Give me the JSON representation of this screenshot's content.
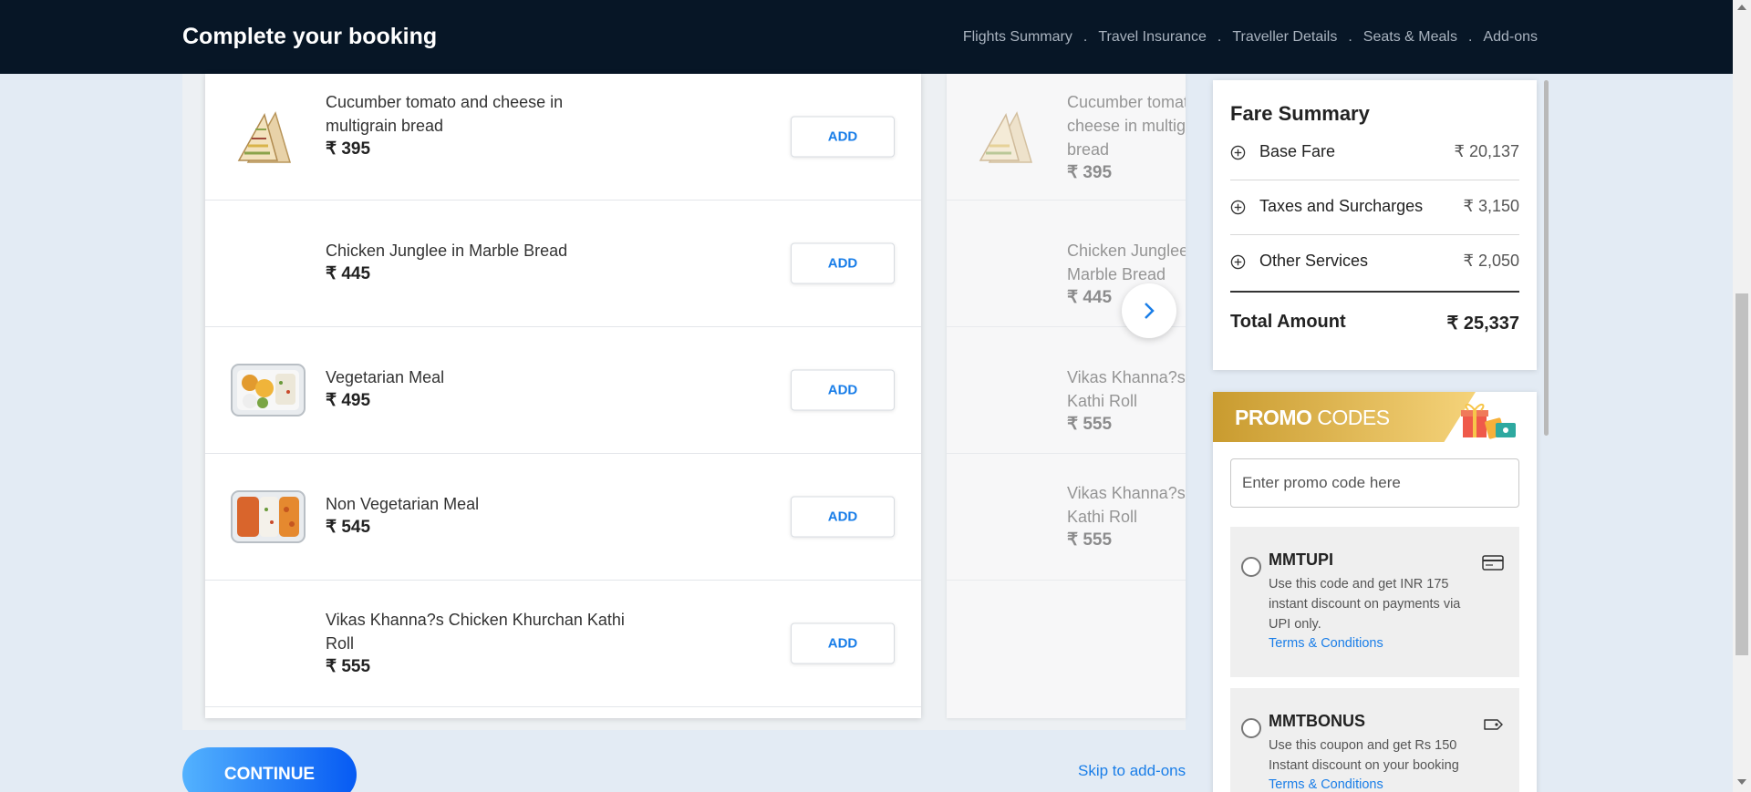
{
  "header": {
    "title": "Complete your booking",
    "steps": [
      "Flights Summary",
      "Travel Insurance",
      "Traveller Details",
      "Seats & Meals",
      "Add-ons"
    ]
  },
  "meals": [
    {
      "name": "Cucumber tomato and cheese in multigrain bread",
      "price": "₹ 395",
      "icon": "sandwich-image"
    },
    {
      "name": "Chicken Junglee in Marble Bread",
      "price": "₹ 445",
      "icon": ""
    },
    {
      "name": "Vegetarian Meal",
      "price": "₹ 495",
      "icon": "veg-meal-image"
    },
    {
      "name": "Non Vegetarian Meal",
      "price": "₹ 545",
      "icon": "nonveg-meal-image"
    },
    {
      "name": "Vikas Khanna?s Chicken Khurchan Kathi Roll",
      "price": "₹ 555",
      "icon": ""
    }
  ],
  "meals_next": [
    {
      "name": "Cucumber tomato and cheese in multigrain bread",
      "price": "₹ 395"
    },
    {
      "name": "Chicken Junglee in Marble Bread",
      "price": "₹ 445"
    },
    {
      "name": "Vikas Khanna?s Paneer Kathi Roll",
      "price": "₹ 555"
    },
    {
      "name": "Vikas Khanna?s Chicken Kathi Roll",
      "price": "₹ 555"
    }
  ],
  "add_label": "ADD",
  "continue_label": "CONTINUE",
  "skip_label": "Skip to add-ons",
  "fare": {
    "title": "Fare Summary",
    "rows": [
      {
        "label": "Base Fare",
        "amount": "₹ 20,137"
      },
      {
        "label": "Taxes and Surcharges",
        "amount": "₹ 3,150"
      },
      {
        "label": "Other Services",
        "amount": "₹ 2,050"
      }
    ],
    "total_label": "Total Amount",
    "total_amount": "₹ 25,337"
  },
  "promo": {
    "title_bold": "PROMO",
    "title_rest": " CODES",
    "placeholder": "Enter promo code here",
    "coupons": [
      {
        "code": "MMTUPI",
        "desc": "Use this code and get INR 175 instant discount on payments via UPI only.",
        "tc": "Terms & Conditions",
        "icon": "card-icon"
      },
      {
        "code": "MMTBONUS",
        "desc": "Use this coupon and get Rs 150 Instant discount on your booking",
        "tc": "Terms & Conditions",
        "icon": "tag-icon"
      }
    ]
  },
  "colors": {
    "header_bg": "#071626",
    "accent": "#1a7ee8",
    "promo_gold": "#c99b2f"
  }
}
